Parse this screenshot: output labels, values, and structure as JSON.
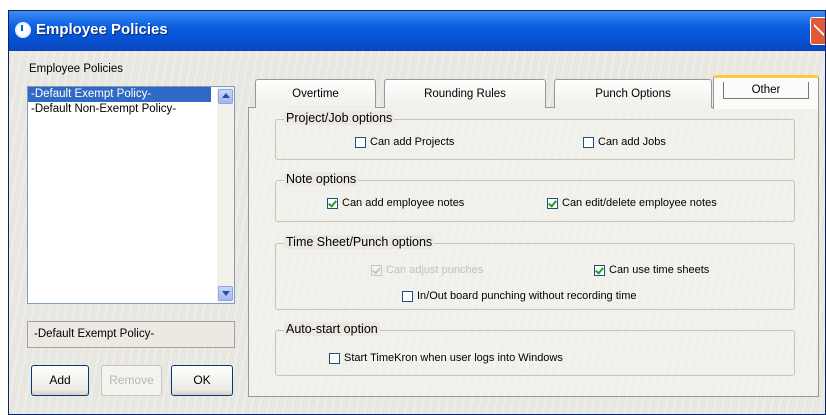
{
  "window": {
    "title": "Employee Policies"
  },
  "left": {
    "list_label": "Employee Policies",
    "items": [
      "-Default Exempt Policy-",
      "-Default Non-Exempt Policy-"
    ],
    "selected_name": "-Default Exempt Policy-",
    "buttons": {
      "add": "Add",
      "remove": "Remove",
      "ok": "OK"
    }
  },
  "tabs": [
    {
      "label": "Overtime"
    },
    {
      "label": "Rounding Rules"
    },
    {
      "label": "Punch Options"
    },
    {
      "label": "Other",
      "active": true
    }
  ],
  "groups": {
    "project": {
      "title": "Project/Job options",
      "can_add_projects": {
        "label": "Can add Projects",
        "checked": false
      },
      "can_add_jobs": {
        "label": "Can add Jobs",
        "checked": false
      }
    },
    "note": {
      "title": "Note options",
      "can_add_notes": {
        "label": "Can add employee notes",
        "checked": true
      },
      "can_edit_notes": {
        "label": "Can edit/delete employee notes",
        "checked": true
      }
    },
    "timesheet": {
      "title": "Time Sheet/Punch options",
      "can_adjust_punches": {
        "label": "Can adjust punches",
        "checked": true,
        "disabled": true
      },
      "can_use_timesheets": {
        "label": "Can use time sheets",
        "checked": true
      },
      "inout_board": {
        "label": "In/Out board punching without recording time",
        "checked": false
      }
    },
    "autostart": {
      "title": "Auto-start option",
      "start_timekron": {
        "label": "Start TimeKron when user logs into Windows",
        "checked": false
      }
    }
  },
  "colors": {
    "titlebar": "#0a5fe0",
    "selection": "#316ac5",
    "active_tab_accent": "#ffc83c"
  }
}
